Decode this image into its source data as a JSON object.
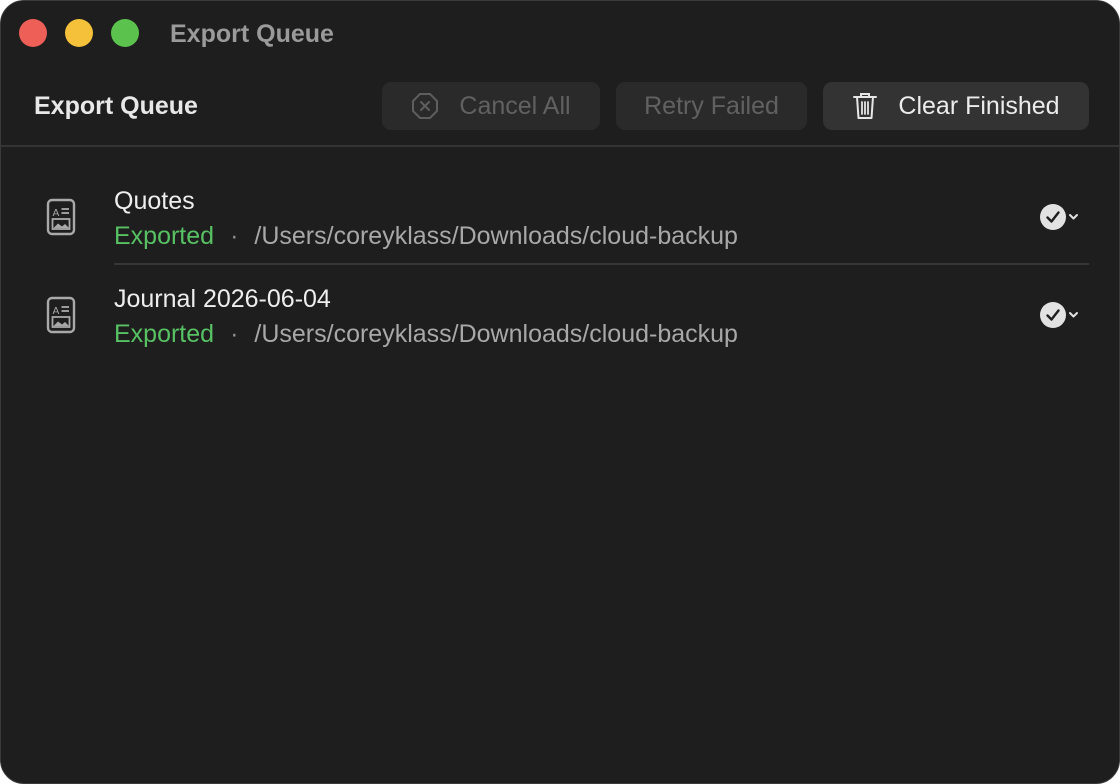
{
  "window": {
    "title": "Export Queue"
  },
  "toolbar": {
    "title": "Export Queue",
    "cancel_all": {
      "label": "Cancel All",
      "enabled": false,
      "icon": "cancel-icon"
    },
    "retry_failed": {
      "label": "Retry Failed",
      "enabled": false
    },
    "clear_finished": {
      "label": "Clear Finished",
      "enabled": true,
      "icon": "trash-icon"
    }
  },
  "items": [
    {
      "name": "Quotes",
      "status": "Exported",
      "separator": "·",
      "path": "/Users/coreyklass/Downloads/cloud-backup",
      "icon": "document-icon",
      "state_icon": "checkmark-circle-icon"
    },
    {
      "name": "Journal 2026-06-04",
      "status": "Exported",
      "separator": "·",
      "path": "/Users/coreyklass/Downloads/cloud-backup",
      "icon": "document-icon",
      "state_icon": "checkmark-circle-icon"
    }
  ],
  "colors": {
    "background": "#1e1e1e",
    "status_exported": "#57c163",
    "close": "#ed5f57",
    "minimize": "#f5c13a",
    "maximize": "#5bc24d"
  }
}
